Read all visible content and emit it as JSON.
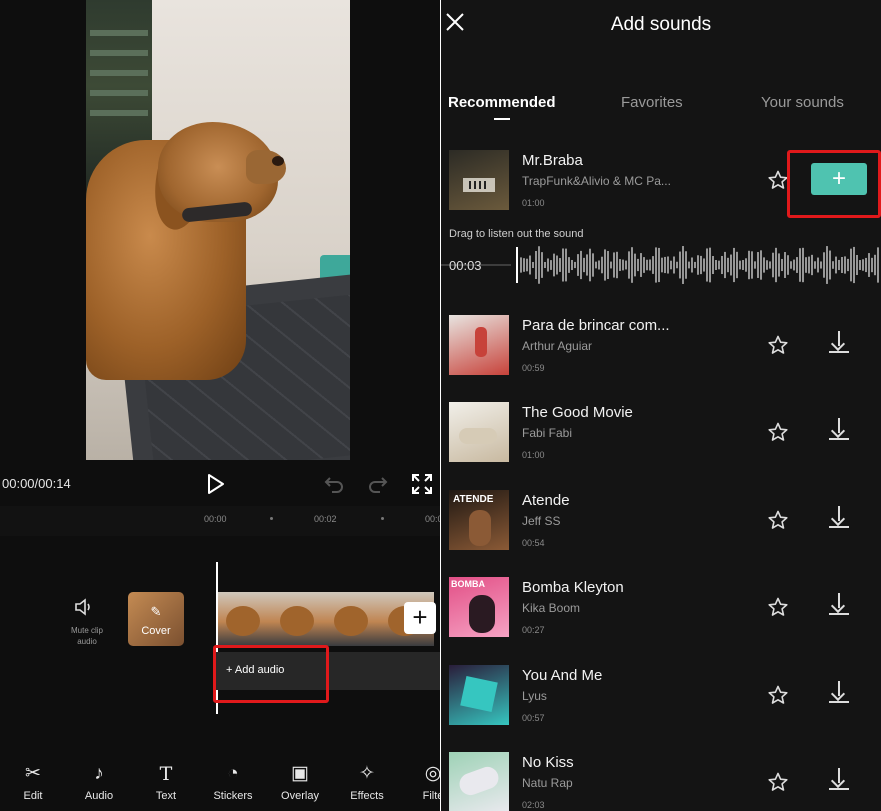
{
  "left_panel": {
    "time_display": "00:00/00:14",
    "ruler_ticks": [
      "00:00",
      "00:02",
      "00:0"
    ],
    "mute_clip_label": "Mute clip audio",
    "cover_label": "Cover",
    "add_audio_label": "+ Add audio",
    "toolbar": [
      {
        "label": "Edit",
        "icon": "scissors-icon",
        "glyph": "✂"
      },
      {
        "label": "Audio",
        "icon": "music-note-icon",
        "glyph": "♪"
      },
      {
        "label": "Text",
        "icon": "text-icon",
        "glyph": "T"
      },
      {
        "label": "Stickers",
        "icon": "sticker-icon",
        "glyph": "◔"
      },
      {
        "label": "Overlay",
        "icon": "overlay-icon",
        "glyph": "▣"
      },
      {
        "label": "Effects",
        "icon": "effects-star-icon",
        "glyph": "✧"
      },
      {
        "label": "Filte",
        "icon": "filter-icon",
        "glyph": "◎"
      }
    ]
  },
  "right_panel": {
    "title": "Add sounds",
    "tabs": [
      {
        "label": "Recommended",
        "active": true
      },
      {
        "label": "Favorites",
        "active": false
      },
      {
        "label": "Your sounds",
        "active": false
      }
    ],
    "drag_hint": "Drag to listen out the sound",
    "waveform_time": "00:03",
    "accent_color": "#4fc3b0",
    "highlight_color": "#e0191b",
    "songs": [
      {
        "title": "Mr.Braba",
        "artist": "TrapFunk&Alivio & MC Pa...",
        "duration": "01:00",
        "action": "add",
        "colors": [
          "#2c2b25",
          "#6b5a3c"
        ]
      },
      {
        "title": "Para de brincar com...",
        "artist": "Arthur Aguiar",
        "duration": "00:59",
        "action": "download",
        "colors": [
          "#e8e4e0",
          "#c7423a"
        ]
      },
      {
        "title": "The Good Movie",
        "artist": "Fabi Fabi",
        "duration": "01:00",
        "action": "download",
        "colors": [
          "#f1efe9",
          "#c8b9a0"
        ]
      },
      {
        "title": "Atende",
        "artist": "Jeff SS",
        "duration": "00:54",
        "action": "download",
        "colors": [
          "#1f1813",
          "#8b5a36"
        ]
      },
      {
        "title": "Bomba Kleyton",
        "artist": "Kika Boom",
        "duration": "00:27",
        "action": "download",
        "colors": [
          "#e24f86",
          "#f6a3c4"
        ]
      },
      {
        "title": "You And Me",
        "artist": "Lyus",
        "duration": "00:57",
        "action": "download",
        "colors": [
          "#2a1d3a",
          "#36c6c0"
        ]
      },
      {
        "title": "No Kiss",
        "artist": "Natu Rap",
        "duration": "02:03",
        "action": "download",
        "colors": [
          "#9ed2b6",
          "#e9e9ee"
        ]
      }
    ]
  }
}
